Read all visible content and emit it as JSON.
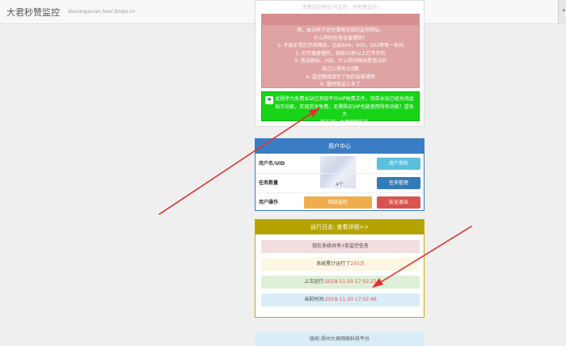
{
  "topbar": {
    "brand": "大君秒赞监控",
    "host": "daxianganian.host.bmps.cn"
  },
  "notice": {
    "faded": "免费监控网站(可监控、可免费监控)",
    "red_lines": [
      "用，本站将不定时清理无效的监控网址。",
      "什么样的任务会被清除？",
      "1: 不能正常打开的网站，比如404，503，502等等一系列",
      "2: 打开速度慢的，例如10秒以上打不开的",
      "3: 违法网站，H站，什么样的网站是违法的",
      "自己心里有点B数",
      "4: 监控链接填写了别的会被清除",
      "6: 暂时就这么多了"
    ],
    "green_lines": [
      "此程序为免费本站已添加平台VIP收费文件，目前本站已经关闭虚",
      "拟币功能，实现完全免费，无需购买VIP也能使用所有功能！望各大",
      "家支持！大君网络科技"
    ],
    "green_icon": "share-icon"
  },
  "user_center": {
    "title": "用户中心",
    "rows": [
      {
        "label": "用户名/UID",
        "value": ""
      },
      {
        "label": "任务数量",
        "value": "4个"
      },
      {
        "label": "用户操作",
        "value": ""
      }
    ],
    "buttons": {
      "profile": "用户资料",
      "task_manage": "任务管理",
      "site_monitor": "网站监控",
      "logout": "安全退出"
    }
  },
  "run_log": {
    "title": "运行日志:  查看详细>>",
    "items": {
      "monitoring_prefix": "现在系统共有",
      "monitoring_count": "4",
      "monitoring_suffix": "条监控任务",
      "uptime_prefix": "系统累计运行了",
      "uptime_value": "255次",
      "last_run_label": "上次运行:",
      "last_run_time": "2018-11-20 17:02:27",
      "current_label": "当前时间:",
      "current_time": "2018-11-20 17:02:46"
    }
  },
  "footer": {
    "text": "版权:扬州大君网络科技平台"
  },
  "annotation_color": "#e52e2e"
}
